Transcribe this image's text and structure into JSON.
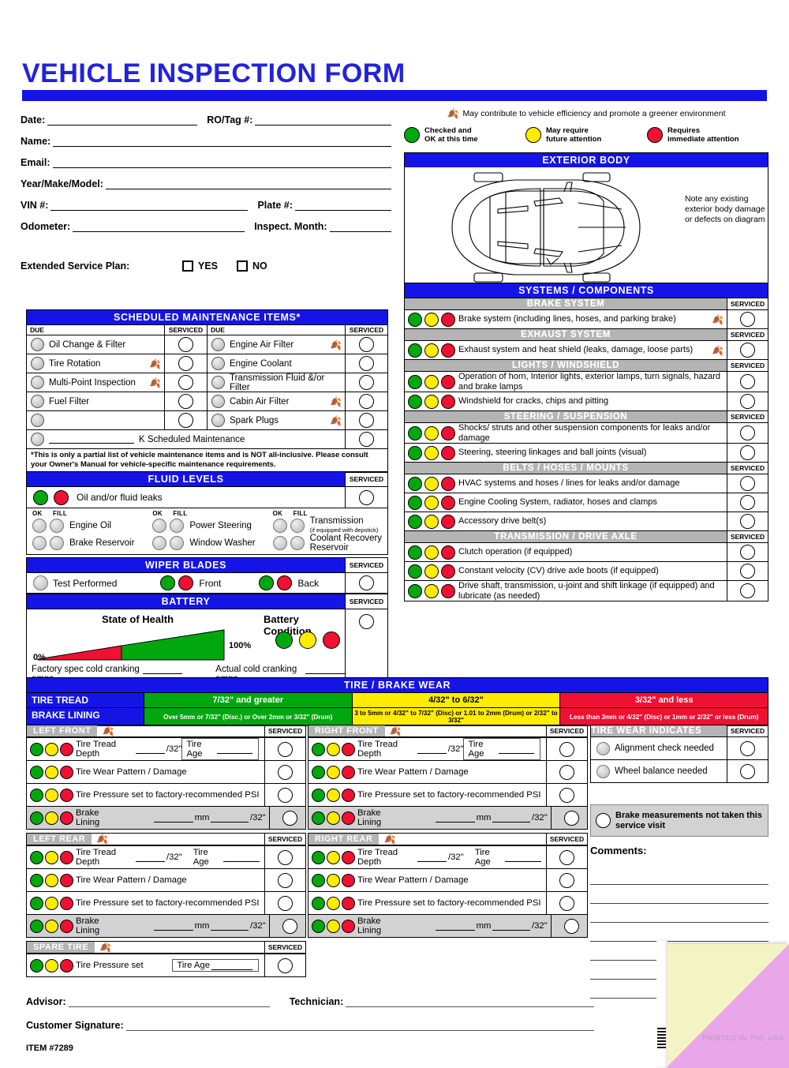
{
  "title": "VEHICLE INSPECTION FORM",
  "customer": {
    "fields": [
      {
        "label": "Date:"
      },
      {
        "label": "RO/Tag #:"
      },
      {
        "label": "Name:"
      },
      {
        "label": "Email:"
      },
      {
        "label": "Year/Make/Model:"
      },
      {
        "label": "VIN #:"
      },
      {
        "label": "Plate #:"
      },
      {
        "label": "Odometer:"
      },
      {
        "label": "Inspect. Month:"
      }
    ],
    "extended_service_plan_label": "Extended Service Plan:",
    "yes_label": "YES",
    "no_label": "NO"
  },
  "legend": {
    "leaf_note": "May contribute to vehicle efficiency and promote a greener environment",
    "items": [
      {
        "color": "#00a80e",
        "line1": "Checked and",
        "line2": "OK at this time"
      },
      {
        "color": "#ffec00",
        "line1": "May require",
        "line2": "future attention"
      },
      {
        "color": "#ee1133",
        "line1": "Requires",
        "line2": "immediate attention"
      }
    ]
  },
  "exterior": {
    "header": "EXTERIOR BODY",
    "note": "Note any existing exterior body damage or defects on diagram"
  },
  "scheduled": {
    "header": "SCHEDULED MAINTENANCE ITEMS*",
    "due_label": "DUE",
    "serviced_label": "SERVICED",
    "left_items": [
      {
        "label": "Oil Change & Filter",
        "leaf": false
      },
      {
        "label": "Tire Rotation",
        "leaf": true
      },
      {
        "label": "Multi-Point Inspection",
        "leaf": true
      },
      {
        "label": "Fuel Filter",
        "leaf": false
      },
      {
        "label": "",
        "leaf": false
      }
    ],
    "right_items": [
      {
        "label": "Engine Air Filter",
        "leaf": true
      },
      {
        "label": "Engine Coolant",
        "leaf": false
      },
      {
        "label": "Transmission Fluid &/or Filter",
        "leaf": false
      },
      {
        "label": "Cabin Air Filter",
        "leaf": true
      },
      {
        "label": "Spark Plugs",
        "leaf": true
      }
    ],
    "k_maintenance_label": "K Scheduled Maintenance",
    "disclaimer": "*This is only a partial list of vehicle maintenance items and is NOT all-inclusive. Please consult your Owner's Manual for vehicle-specific maintenance requirements."
  },
  "fluids": {
    "header": "FLUID LEVELS",
    "serviced_label": "SERVICED",
    "leak_label": "Oil and/or fluid leaks",
    "ok_label": "OK",
    "fill_label": "FILL",
    "groups": [
      {
        "items": [
          {
            "name": "Engine Oil"
          },
          {
            "name": "Brake Reservoir"
          }
        ]
      },
      {
        "items": [
          {
            "name": "Power Steering"
          },
          {
            "name": "Window Washer"
          }
        ]
      },
      {
        "items": [
          {
            "name": "Transmission",
            "sub": "(if equipped with depstick)"
          },
          {
            "name": "Coolant Recovery Reservoir"
          }
        ]
      }
    ]
  },
  "wipers": {
    "header": "WIPER BLADES",
    "serviced_label": "SERVICED",
    "test_label": "Test Performed",
    "front_label": "Front",
    "back_label": "Back"
  },
  "battery": {
    "header": "BATTERY",
    "serviced_label": "SERVICED",
    "state_of_health": "State of Health",
    "pct_min": "0%",
    "pct_max": "100%",
    "condition_title": "Battery Condition",
    "factory_label": "Factory spec cold cranking amps",
    "actual_label": "Actual cold cranking amps"
  },
  "systems": {
    "header": "SYSTEMS / COMPONENTS",
    "serviced_label": "SERVICED",
    "sections": [
      {
        "name": "BRAKE SYSTEM",
        "rows": [
          {
            "label": "Brake system (including lines, hoses, and parking brake)",
            "leaf": true
          }
        ]
      },
      {
        "name": "EXHAUST SYSTEM",
        "rows": [
          {
            "label": "Exhaust system and heat shield (leaks, damage, loose parts)",
            "leaf": true
          }
        ]
      },
      {
        "name": "LIGHTS / WINDSHIELD",
        "rows": [
          {
            "label": "Operation of horn, Interior lights, exterior lamps, turn signals, hazard and brake lamps",
            "leaf": false
          },
          {
            "label": "Windshield for cracks, chips and pitting",
            "leaf": false
          }
        ]
      },
      {
        "name": "STEERING / SUSPENSION",
        "rows": [
          {
            "label": "Shocks/ struts and other suspension components for leaks and/or damage",
            "leaf": false
          },
          {
            "label": "Steering, steering linkages and ball joints (visual)",
            "leaf": false
          }
        ]
      },
      {
        "name": "BELTS / HOSES / MOUNTS",
        "rows": [
          {
            "label": "HVAC systems and hoses / lines for leaks and/or damage",
            "leaf": false
          },
          {
            "label": "Engine Cooling System, radiator, hoses and clamps",
            "leaf": false
          },
          {
            "label": "Accessory drive belt(s)",
            "leaf": false
          }
        ]
      },
      {
        "name": "TRANSMISSION / DRIVE AXLE",
        "rows": [
          {
            "label": "Clutch operation (if equipped)",
            "leaf": false
          },
          {
            "label": "Constant velocity (CV) drive axle boots (if equipped)",
            "leaf": false
          },
          {
            "label": "Drive shaft, transmission, u-joint and shift linkage (if equipped) and lubricate (as needed)",
            "leaf": false
          }
        ]
      }
    ]
  },
  "tire_wear": {
    "header": "TIRE / BRAKE WEAR",
    "rows": [
      {
        "category": "TIRE TREAD",
        "cells": [
          {
            "text": "7/32\" and greater",
            "color": "#00a80e"
          },
          {
            "text": "4/32\" to 6/32\"",
            "color": "#ffec00"
          },
          {
            "text": "3/32\" and less",
            "color": "#ee1133"
          }
        ]
      },
      {
        "category": "BRAKE LINING",
        "cells": [
          {
            "text": "Over 5mm or 7/32\" (Disc.) or Over 2mm or 3/32\" (Drum)",
            "color": "#00a80e"
          },
          {
            "text": "3 to 5mm or 4/32\" to 7/32\" (Disc) or 1.01 to 2mm (Drum) or 2/32\" to 3/32\"",
            "color": "#ffec00"
          },
          {
            "text": "Less than 3mm or 4/32\" (Disc) or 1mm or 2/32\" or less (Drum)",
            "color": "#ee1133"
          }
        ]
      }
    ]
  },
  "quadrants": [
    {
      "name": "LEFT FRONT",
      "serviced_label": "SERVICED",
      "rows": [
        {
          "type": "tread",
          "label": "Tire Tread Depth",
          "unit": "/32\"",
          "age_label": "Tire Age",
          "boxed": true
        },
        {
          "type": "plain",
          "label": "Tire Wear Pattern / Damage"
        },
        {
          "type": "plain",
          "label": "Tire Pressure set to factory-recommended PSI"
        },
        {
          "type": "lining",
          "label": "Brake Lining",
          "mm": "mm",
          "unit": "/32\""
        }
      ]
    },
    {
      "name": "RIGHT FRONT",
      "serviced_label": "SERVICED",
      "rows": [
        {
          "type": "tread",
          "label": "Tire Tread Depth",
          "unit": "/32\"",
          "age_label": "Tire Age",
          "boxed": true
        },
        {
          "type": "plain",
          "label": "Tire Wear Pattern / Damage"
        },
        {
          "type": "plain",
          "label": "Tire Pressure set to factory-recommended PSI"
        },
        {
          "type": "lining",
          "label": "Brake Lining",
          "mm": "mm",
          "unit": "/32\""
        }
      ]
    },
    {
      "name": "LEFT REAR",
      "serviced_label": "SERVICED",
      "rows": [
        {
          "type": "tread",
          "label": "Tire Tread Depth",
          "unit": "/32\"",
          "age_label": "Tire Age",
          "boxed": false
        },
        {
          "type": "plain",
          "label": "Tire Wear Pattern / Damage"
        },
        {
          "type": "plain",
          "label": "Tire Pressure set to factory-recommended PSI"
        },
        {
          "type": "lining",
          "label": "Brake Lining",
          "mm": "mm",
          "unit": "/32\""
        }
      ]
    },
    {
      "name": "RIGHT REAR",
      "serviced_label": "SERVICED",
      "rows": [
        {
          "type": "tread",
          "label": "Tire Tread Depth",
          "unit": "/32\"",
          "age_label": "Tire Age",
          "boxed": false
        },
        {
          "type": "plain",
          "label": "Tire Wear Pattern / Damage"
        },
        {
          "type": "plain",
          "label": "Tire Pressure set to factory-recommended PSI"
        },
        {
          "type": "lining",
          "label": "Brake Lining",
          "mm": "mm",
          "unit": "/32\""
        }
      ]
    }
  ],
  "spare": {
    "name": "SPARE TIRE",
    "serviced_label": "SERVICED",
    "label": "Tire Pressure set",
    "age_label": "Tire Age"
  },
  "tire_wear_indicates": {
    "header": "TIRE WEAR INDICATES",
    "serviced_label": "SERVICED",
    "items": [
      {
        "label": "Alignment check needed"
      },
      {
        "label": "Wheel balance needed"
      }
    ],
    "no_brake_note": "Brake measurements not taken this service visit"
  },
  "comments": {
    "header": "Comments:"
  },
  "footer": {
    "advisor_label": "Advisor:",
    "technician_label": "Technician:",
    "customer_signature_label": "Customer Signature:",
    "item_number": "ITEM #7289",
    "printed_in_usa": "PRINTED IN THE USA"
  }
}
